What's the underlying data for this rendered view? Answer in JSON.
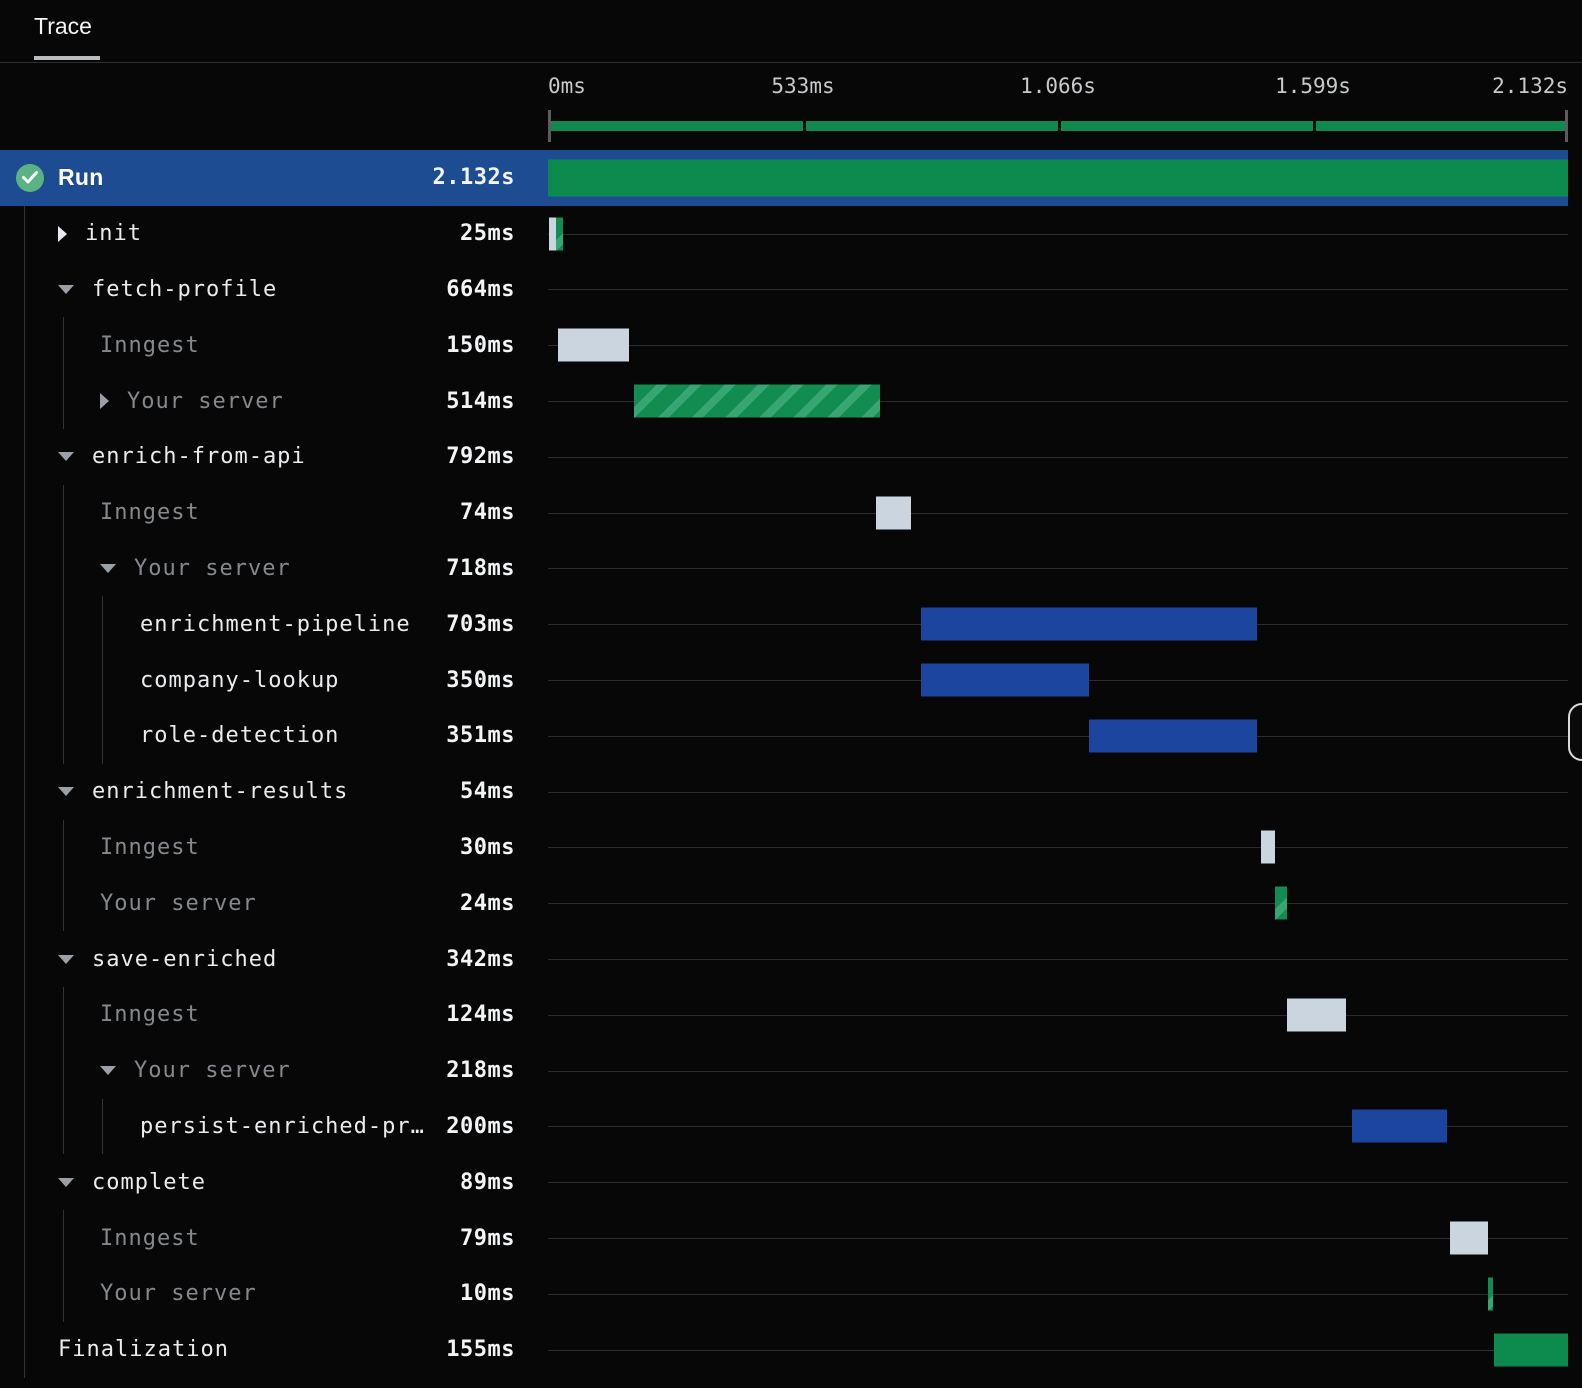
{
  "tab": {
    "label": "Trace"
  },
  "axis": {
    "total_ms": 2132,
    "ticks": [
      {
        "label": "0ms",
        "pos": 0,
        "align": "left"
      },
      {
        "label": "533ms",
        "pos": 25,
        "align": "center"
      },
      {
        "label": "1.066s",
        "pos": 50,
        "align": "center"
      },
      {
        "label": "1.599s",
        "pos": 75,
        "align": "center"
      },
      {
        "label": "2.132s",
        "pos": 100,
        "align": "right"
      }
    ]
  },
  "colors": {
    "accent_green": "#0d8a4e",
    "bar_blue": "#1c45a0",
    "bar_gray": "#cbd5e0",
    "selected_row_blue": "#1e4c93",
    "check_badge_green": "#5bb383"
  },
  "rows": [
    {
      "name": "Run",
      "duration": "2.132s",
      "depth": 0,
      "variant": "run",
      "selected": true,
      "status_icon": "check-circle",
      "expand": null,
      "name_color": "white",
      "bars": [
        {
          "color": "green",
          "start": 0,
          "dur": 2132,
          "run": true
        }
      ]
    },
    {
      "name": "init",
      "duration": "25ms",
      "depth": 1,
      "expand": "collapsed",
      "name_color": "white",
      "bars": [
        {
          "color": "gray",
          "start": 2,
          "dur": 15
        },
        {
          "color": "greenh",
          "start": 17,
          "dur": 14
        }
      ]
    },
    {
      "name": "fetch-profile",
      "duration": "664ms",
      "depth": 1,
      "expand": "expanded",
      "name_color": "white",
      "bars": []
    },
    {
      "name": "Inngest",
      "duration": "150ms",
      "depth": 2,
      "expand": null,
      "name_color": "gray",
      "bars": [
        {
          "color": "gray",
          "start": 20,
          "dur": 150
        }
      ]
    },
    {
      "name": "Your server",
      "duration": "514ms",
      "depth": 2,
      "expand": "collapsed",
      "name_color": "gray",
      "bars": [
        {
          "color": "greenh",
          "start": 180,
          "dur": 514
        }
      ]
    },
    {
      "name": "enrich-from-api",
      "duration": "792ms",
      "depth": 1,
      "expand": "expanded",
      "name_color": "white",
      "bars": []
    },
    {
      "name": "Inngest",
      "duration": "74ms",
      "depth": 2,
      "expand": null,
      "name_color": "gray",
      "bars": [
        {
          "color": "gray",
          "start": 685,
          "dur": 74
        }
      ]
    },
    {
      "name": "Your server",
      "duration": "718ms",
      "depth": 2,
      "expand": "expanded",
      "name_color": "gray",
      "bars": []
    },
    {
      "name": "enrichment-pipeline",
      "duration": "703ms",
      "depth": 3,
      "expand": null,
      "name_color": "white",
      "bars": [
        {
          "color": "blue",
          "start": 780,
          "dur": 703
        }
      ]
    },
    {
      "name": "company-lookup",
      "duration": "350ms",
      "depth": 3,
      "expand": null,
      "name_color": "white",
      "bars": [
        {
          "color": "blue",
          "start": 780,
          "dur": 350
        }
      ]
    },
    {
      "name": "role-detection",
      "duration": "351ms",
      "depth": 3,
      "expand": null,
      "name_color": "white",
      "bars": [
        {
          "color": "blue",
          "start": 1130,
          "dur": 351
        }
      ]
    },
    {
      "name": "enrichment-results",
      "duration": "54ms",
      "depth": 1,
      "expand": "expanded",
      "name_color": "white",
      "bars": []
    },
    {
      "name": "Inngest",
      "duration": "30ms",
      "depth": 2,
      "expand": null,
      "name_color": "gray",
      "bars": [
        {
          "color": "gray",
          "start": 1490,
          "dur": 30
        }
      ]
    },
    {
      "name": "Your server",
      "duration": "24ms",
      "depth": 2,
      "expand": null,
      "name_color": "gray",
      "bars": [
        {
          "color": "greenh",
          "start": 1520,
          "dur": 24
        }
      ]
    },
    {
      "name": "save-enriched",
      "duration": "342ms",
      "depth": 1,
      "expand": "expanded",
      "name_color": "white",
      "bars": []
    },
    {
      "name": "Inngest",
      "duration": "124ms",
      "depth": 2,
      "expand": null,
      "name_color": "gray",
      "bars": [
        {
          "color": "gray",
          "start": 1545,
          "dur": 124
        }
      ]
    },
    {
      "name": "Your server",
      "duration": "218ms",
      "depth": 2,
      "expand": "expanded",
      "name_color": "gray",
      "bars": []
    },
    {
      "name": "persist-enriched-pr…",
      "duration": "200ms",
      "depth": 3,
      "expand": null,
      "name_color": "white",
      "bars": [
        {
          "color": "blue",
          "start": 1680,
          "dur": 200
        }
      ]
    },
    {
      "name": "complete",
      "duration": "89ms",
      "depth": 1,
      "expand": "expanded",
      "name_color": "white",
      "bars": []
    },
    {
      "name": "Inngest",
      "duration": "79ms",
      "depth": 2,
      "expand": null,
      "name_color": "gray",
      "bars": [
        {
          "color": "gray",
          "start": 1885,
          "dur": 79
        }
      ]
    },
    {
      "name": "Your server",
      "duration": "10ms",
      "depth": 2,
      "expand": null,
      "name_color": "gray",
      "bars": [
        {
          "color": "greenh",
          "start": 1965,
          "dur": 10
        }
      ]
    },
    {
      "name": "Finalization",
      "duration": "155ms",
      "depth": 1,
      "expand": null,
      "name_color": "white",
      "bars": [
        {
          "color": "green",
          "start": 1977,
          "dur": 155
        }
      ]
    }
  ]
}
